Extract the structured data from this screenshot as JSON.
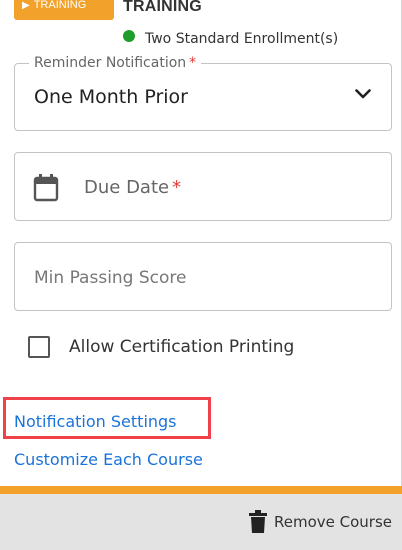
{
  "header": {
    "tag_label": "TRAINING",
    "course_title": "TRAINING",
    "enrollment_text": "Two Standard Enrollment(s)",
    "status_color": "#1f9d2a"
  },
  "reminder": {
    "label": "Reminder Notification",
    "required_mark": "*",
    "value": "One Month Prior",
    "icon": "chevron-down-icon"
  },
  "due_date": {
    "placeholder": "Due Date",
    "required_mark": "*",
    "icon": "calendar-icon"
  },
  "passing_score": {
    "placeholder": "Min Passing Score"
  },
  "certification": {
    "label": "Allow Certification Printing",
    "checked": false
  },
  "links": {
    "notification_settings": "Notification Settings",
    "customize_each_course": "Customize Each Course"
  },
  "footer": {
    "remove_label": "Remove Course",
    "icon": "trash-icon"
  },
  "colors": {
    "accent": "#f2a22a",
    "link": "#1a73d9",
    "required": "#e53935",
    "highlight": "#f0404a"
  }
}
